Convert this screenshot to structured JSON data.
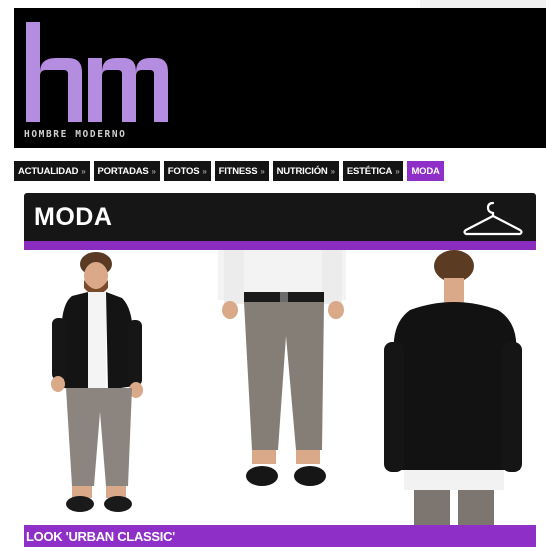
{
  "logo": {
    "mark": "hm",
    "text": "HOMBRE MODERNO"
  },
  "nav": {
    "items": [
      {
        "label": "ACTUALIDAD",
        "chevron": "»"
      },
      {
        "label": "PORTADAS",
        "chevron": "»"
      },
      {
        "label": "FOTOS",
        "chevron": "»"
      },
      {
        "label": "FITNESS",
        "chevron": "»"
      },
      {
        "label": "NUTRICIÓN",
        "chevron": "»"
      },
      {
        "label": "ESTÉTICA",
        "chevron": "»"
      },
      {
        "label": "MODA",
        "chevron": ""
      }
    ],
    "active": "MODA"
  },
  "section": {
    "title": "MODA",
    "icon": "hanger-icon"
  },
  "article": {
    "caption": "LOOK 'URBAN CLASSIC'"
  },
  "colors": {
    "accent": "#8e2fc7",
    "logo": "#b48ce0",
    "header_bg": "#000000",
    "nav_bg": "#141414"
  }
}
